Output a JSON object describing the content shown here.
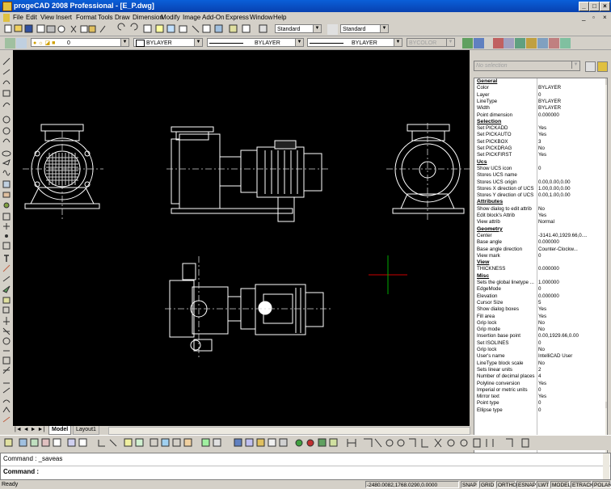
{
  "window": {
    "title": "progeCAD 2008 Professional - [E_P.dwg]"
  },
  "menu": [
    "File",
    "Edit",
    "View",
    "Insert",
    "Format",
    "Tools",
    "Draw",
    "Dimension",
    "Modify",
    "Image",
    "Add-On",
    "Express",
    "Window",
    "Help"
  ],
  "toolbar": {
    "style1": "Standard",
    "style2": "Standard",
    "layer": "0",
    "color": "BYLAYER",
    "linetype": "BYLAYER",
    "lineweight": "BYLAYER",
    "plotstyle": "BYCOLOR"
  },
  "tabs": [
    "Model",
    "Layout1"
  ],
  "properties": {
    "selection": "No selection",
    "rows": [
      {
        "k": "General",
        "cat": true
      },
      {
        "k": "Color",
        "v": "BYLAYER"
      },
      {
        "k": "Layer",
        "v": "0"
      },
      {
        "k": "LineType",
        "v": "BYLAYER"
      },
      {
        "k": "Width",
        "v": "BYLAYER"
      },
      {
        "k": "Point dimension",
        "v": "0.000000"
      },
      {
        "k": "Selection",
        "cat": true
      },
      {
        "k": "Set PICKADD",
        "v": "Yes"
      },
      {
        "k": "Set PICKAUTO",
        "v": "Yes"
      },
      {
        "k": "Set PICKBOX",
        "v": "3"
      },
      {
        "k": "Set PICKDRAG",
        "v": "No"
      },
      {
        "k": "Set PICKFIRST",
        "v": "Yes"
      },
      {
        "k": "Ucs",
        "cat": true
      },
      {
        "k": "Show UCS icon",
        "v": "0"
      },
      {
        "k": "Stores UCS name",
        "v": ""
      },
      {
        "k": "Stores UCS origin",
        "v": "0.00,0.00,0.00"
      },
      {
        "k": "Stores X direction of UCS",
        "v": "1.00,0.00,0.00"
      },
      {
        "k": "Stores Y direction of UCS",
        "v": "0.00,1.00,0.00"
      },
      {
        "k": "Attributes",
        "cat": true
      },
      {
        "k": "Show dialog to edit attrib",
        "v": "No"
      },
      {
        "k": "Edit block's Attrib",
        "v": "Yes"
      },
      {
        "k": "View attrib",
        "v": "Normal"
      },
      {
        "k": "Geometry",
        "cat": true
      },
      {
        "k": "Center",
        "v": "-3141.40,1929.66,0...."
      },
      {
        "k": "Base angle",
        "v": "0.000000"
      },
      {
        "k": "Base angle direction",
        "v": "Counter-Clockw..."
      },
      {
        "k": "View mark",
        "v": "0"
      },
      {
        "k": "View",
        "cat": true
      },
      {
        "k": "THICKNESS",
        "v": "0.000000"
      },
      {
        "k": "Misc",
        "cat": true
      },
      {
        "k": "Sets the global linetype ...",
        "v": "1.000000"
      },
      {
        "k": "EdgeMode",
        "v": "0"
      },
      {
        "k": "Elevation",
        "v": "0.000000"
      },
      {
        "k": "Cursor Size",
        "v": "5"
      },
      {
        "k": "Show dialog boxes",
        "v": "Yes"
      },
      {
        "k": "Fill area",
        "v": "Yes"
      },
      {
        "k": "Grip lock",
        "v": "No"
      },
      {
        "k": "Grip mode",
        "v": "No"
      },
      {
        "k": "Insertion base point",
        "v": "0.00,1929.66,0.00"
      },
      {
        "k": "Set ISOLINES",
        "v": "0"
      },
      {
        "k": "Grip lock",
        "v": "No"
      },
      {
        "k": "User's name",
        "v": "IntelliCAD User"
      },
      {
        "k": "LineType block scale",
        "v": "No"
      },
      {
        "k": "Sets linear units",
        "v": "2"
      },
      {
        "k": "Number of decimal places",
        "v": "4"
      },
      {
        "k": "Polyline conversion",
        "v": "Yes"
      },
      {
        "k": "Imperial or metric units",
        "v": "0"
      },
      {
        "k": "Mirror text",
        "v": "Yes"
      },
      {
        "k": "Point type",
        "v": "0"
      },
      {
        "k": "Ellipse type",
        "v": "0"
      }
    ]
  },
  "command": {
    "history": "Command : _saveas",
    "prompt": "Command :"
  },
  "status": {
    "text": "Ready",
    "coords": "-2480.0082,1768.0290,0.0000",
    "toggles": [
      "SNAP",
      "GRID",
      "ORTHO",
      "ESNAP",
      "LWT",
      "MODEL",
      "ETRACK",
      "POLAR"
    ]
  },
  "colors": {
    "canvas": "#000000",
    "title": "#0a5fd8",
    "crosshairX": "#cc0000",
    "crosshairY": "#00aa00"
  }
}
